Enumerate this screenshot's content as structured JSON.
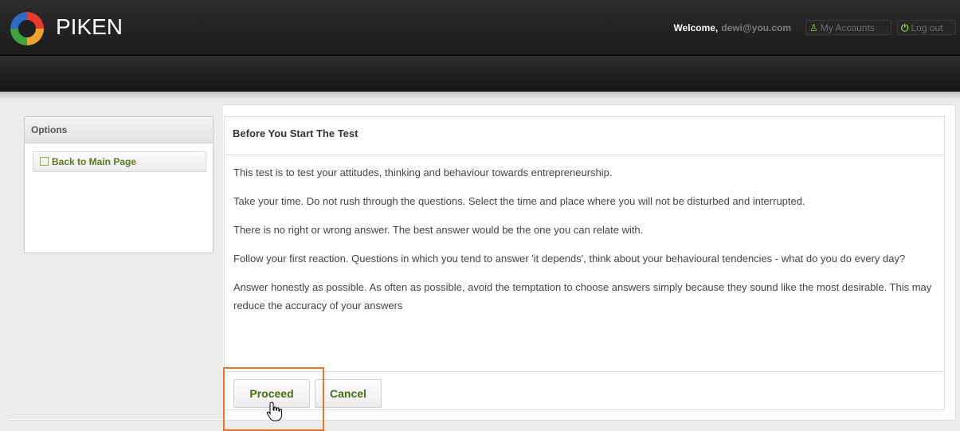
{
  "header": {
    "brand": "PIKEN",
    "welcome_label": "Welcome,",
    "user_email": "dewi@you.com",
    "my_accounts_label": "My Accounts",
    "logout_label": "Log out"
  },
  "sidebar": {
    "title": "Options",
    "back_link_label": "Back to Main Page"
  },
  "main": {
    "title": "Before You Start The Test",
    "paragraphs": [
      "This test is to test your attitudes, thinking and behaviour towards entrepreneurship.",
      "Take your time. Do not rush through the questions. Select the time and place where you will not be disturbed and interrupted.",
      "There is no right or wrong answer. The best answer would be the one you can relate with.",
      "Follow your first reaction. Questions in which you tend to answer 'it depends', think about your behavioural tendencies - what do you do every day?",
      "Answer honestly as possible. As often as possible, avoid the temptation to choose answers simply because they sound like the most desirable. This may reduce the accuracy of your answers"
    ],
    "proceed_label": "Proceed",
    "cancel_label": "Cancel"
  },
  "colors": {
    "accent_green": "#5a7a1c",
    "highlight_orange": "#e8742a",
    "header_bg": "#1c1c1c"
  }
}
